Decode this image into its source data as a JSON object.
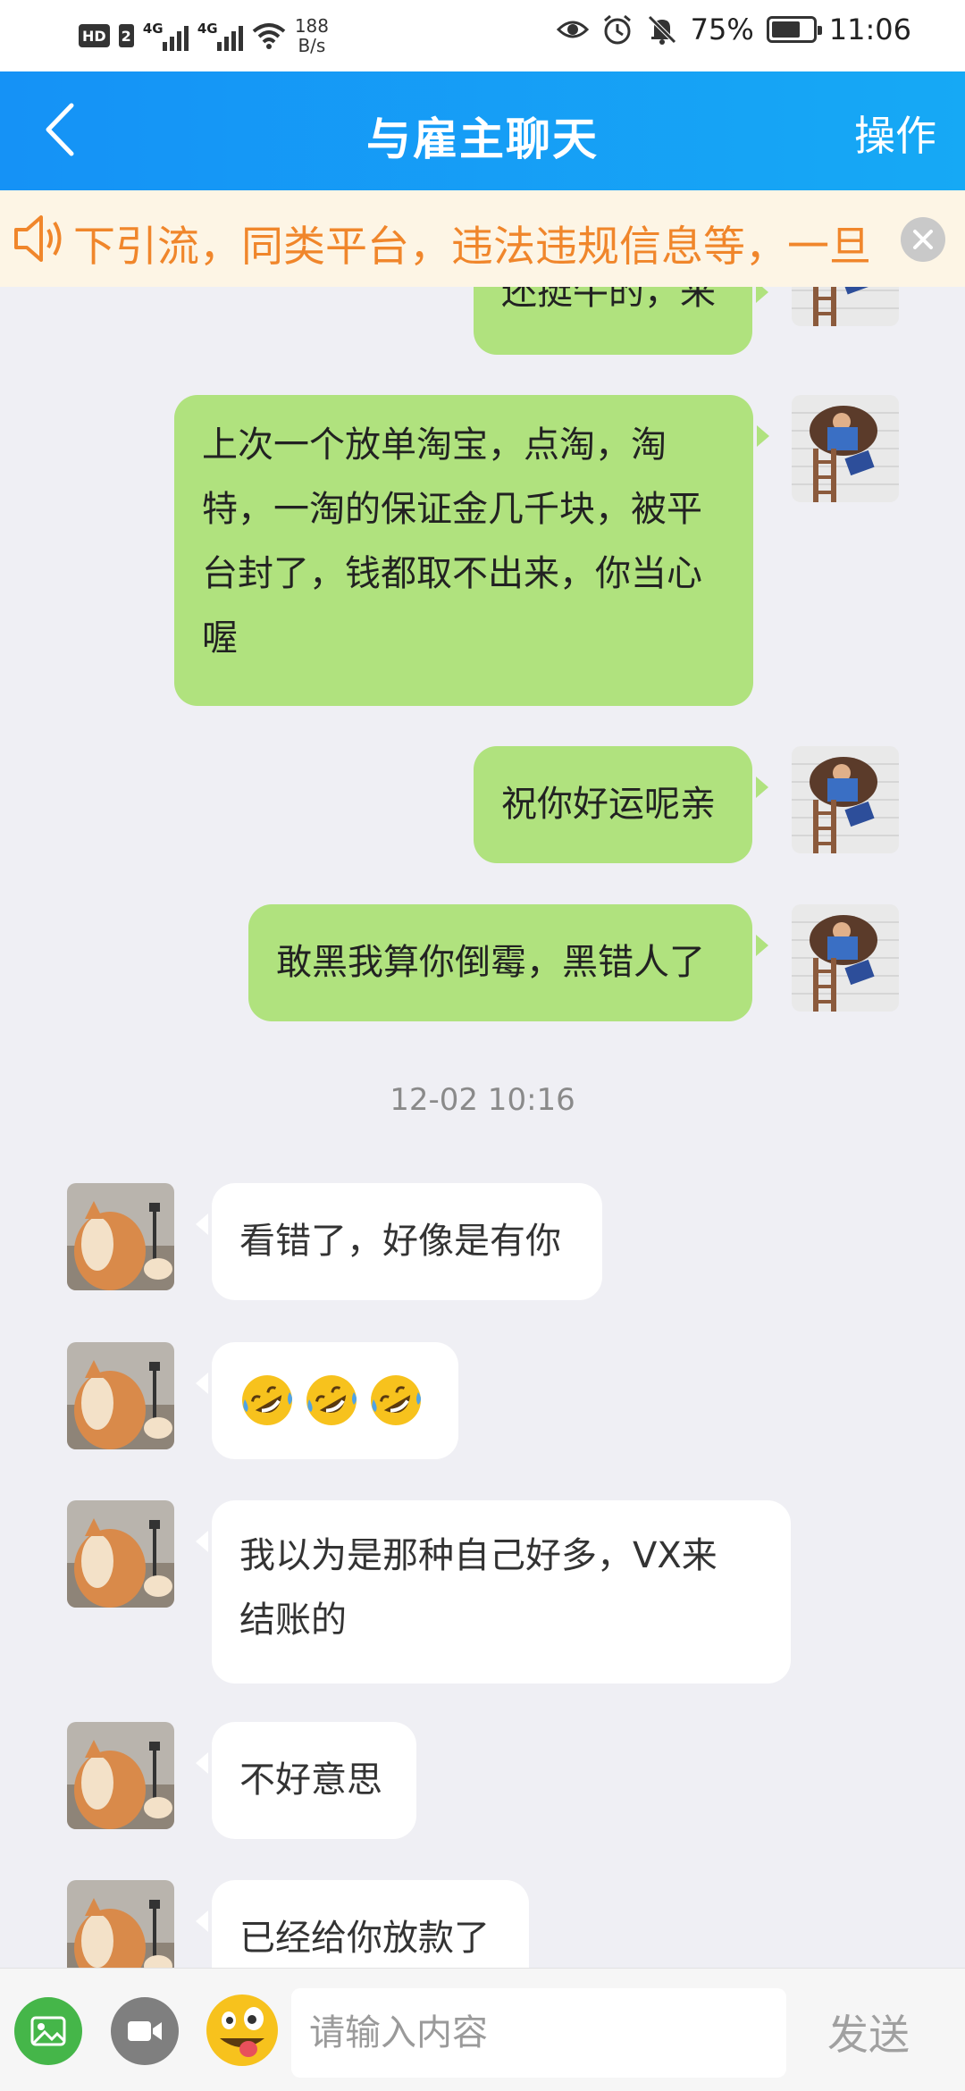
{
  "status_bar": {
    "hd": "HD",
    "sim": "2",
    "net1": "4G",
    "net2": "4G",
    "speed_value": "188",
    "speed_unit": "B/s",
    "battery_percent": "75%",
    "battery_level": 0.75,
    "time": "11:06"
  },
  "header": {
    "title": "与雇主聊天",
    "action_label": "操作"
  },
  "notice": {
    "text": "下引流，同类平台，违法违规信息等，一旦"
  },
  "messages": {
    "m0": {
      "lines": [
        "还挺牛的，来"
      ]
    },
    "m1": {
      "lines": [
        "上次一个放单淘宝，点淘，淘",
        "特，一淘的保证金几千块，被平",
        "台封了，钱都取不出来，你当心",
        "喔"
      ]
    },
    "m2": {
      "lines": [
        "祝你好运呢亲"
      ]
    },
    "m3": {
      "lines": [
        "敢黑我算你倒霉，黑错人了"
      ]
    },
    "timestamp": "12-02 10:16",
    "m4": {
      "lines": [
        "看错了，好像是有你"
      ]
    },
    "m5": {
      "emojis": [
        "rolling-on-floor-laughing",
        "rolling-on-floor-laughing",
        "rolling-on-floor-laughing"
      ]
    },
    "m6": {
      "lines": [
        "我以为是那种自己好多，VX来",
        "结账的"
      ]
    },
    "m7": {
      "lines": [
        "不好意思"
      ]
    },
    "m8": {
      "lines": [
        "已经给你放款了"
      ]
    }
  },
  "input_bar": {
    "placeholder": "请输入内容",
    "send_label": "发送",
    "icons": [
      "image-icon",
      "video-call-icon",
      "emoji-icon"
    ]
  },
  "colors": {
    "header_start": "#1592f6",
    "header_end": "#16a9f5",
    "my_bubble": "#b0e27e",
    "their_bubble": "#ffffff",
    "notice_text": "#f0862b",
    "background": "#efeff4"
  }
}
